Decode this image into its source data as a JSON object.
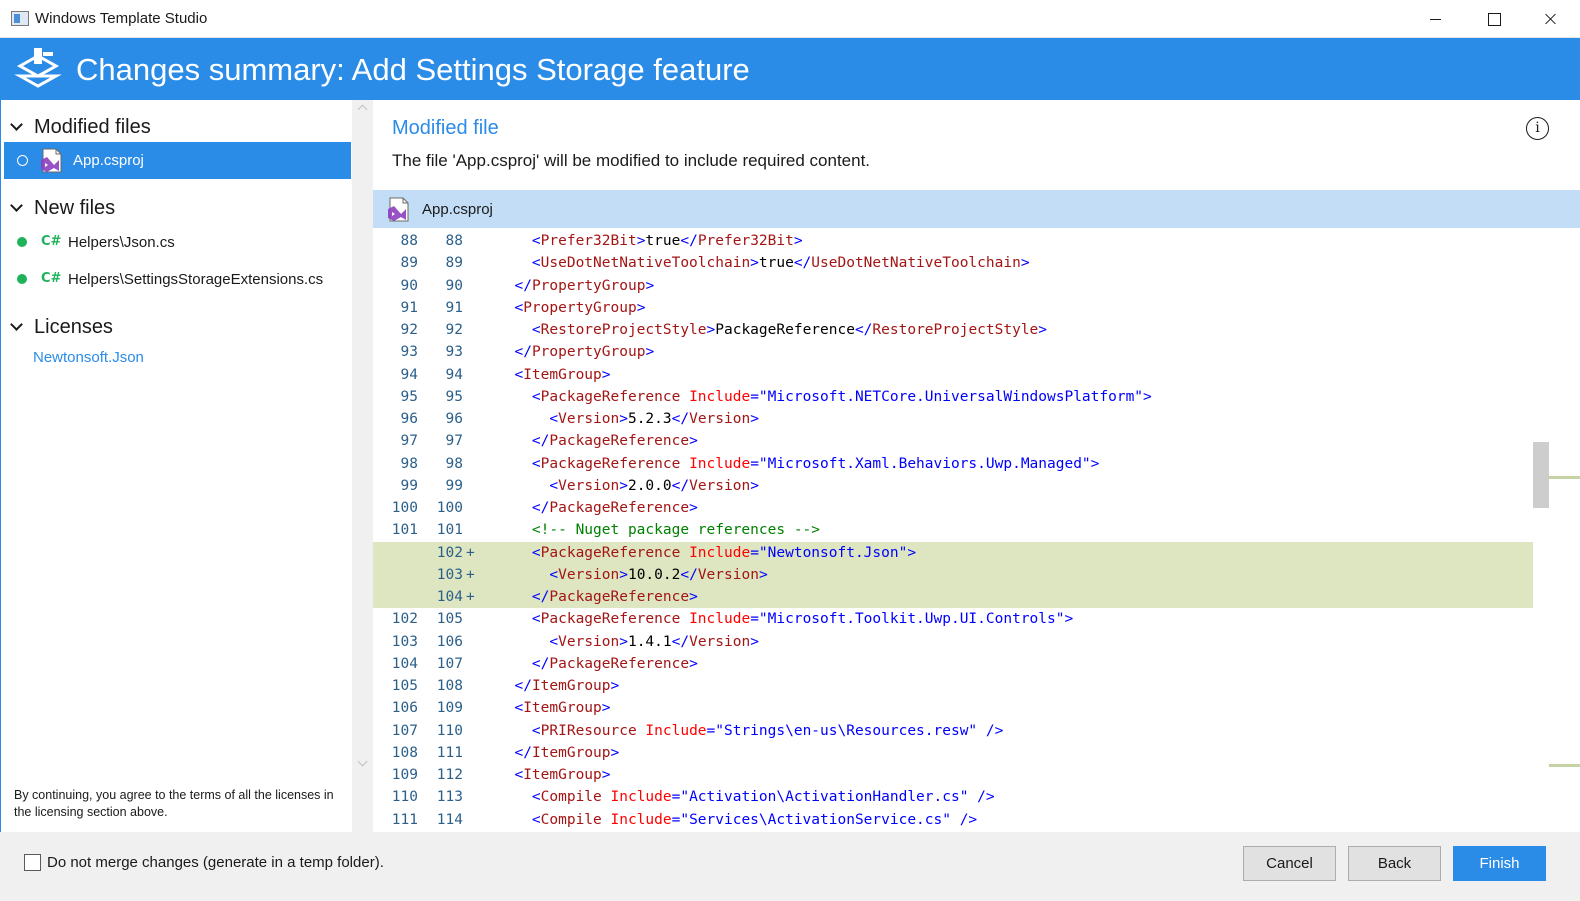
{
  "window": {
    "title": "Windows Template Studio"
  },
  "header": {
    "title": "Changes summary: Add Settings Storage feature"
  },
  "sidebar": {
    "groups": [
      {
        "label": "Modified files",
        "items": [
          {
            "label": "App.csproj",
            "selected": true
          }
        ]
      },
      {
        "label": "New files",
        "items": [
          {
            "label": "Helpers\\Json.cs",
            "icon": "csharp-icon"
          },
          {
            "label": "Helpers\\SettingsStorageExtensions.cs",
            "icon": "csharp-icon"
          }
        ]
      },
      {
        "label": "Licenses",
        "items": [
          {
            "label": "Newtonsoft.Json"
          }
        ]
      }
    ],
    "terms": "By continuing, you agree to the terms of all the licenses in the licensing section above."
  },
  "main": {
    "title": "Modified file",
    "description": "The file 'App.csproj' will be modified to include required content.",
    "file_name": "App.csproj"
  },
  "code_lines": [
    {
      "old": "88",
      "new": "88",
      "mark": "",
      "added": false,
      "segs": [
        [
          "",
          "    "
        ],
        [
          "br",
          "<"
        ],
        [
          "tag",
          "Prefer32Bit"
        ],
        [
          "br",
          ">"
        ],
        [
          "txt",
          "true"
        ],
        [
          "br",
          "</"
        ],
        [
          "tag",
          "Prefer32Bit"
        ],
        [
          "br",
          ">"
        ]
      ]
    },
    {
      "old": "89",
      "new": "89",
      "mark": "",
      "added": false,
      "segs": [
        [
          "",
          "    "
        ],
        [
          "br",
          "<"
        ],
        [
          "tag",
          "UseDotNetNativeToolchain"
        ],
        [
          "br",
          ">"
        ],
        [
          "txt",
          "true"
        ],
        [
          "br",
          "</"
        ],
        [
          "tag",
          "UseDotNetNativeToolchain"
        ],
        [
          "br",
          ">"
        ]
      ]
    },
    {
      "old": "90",
      "new": "90",
      "mark": "",
      "added": false,
      "segs": [
        [
          "",
          "  "
        ],
        [
          "br",
          "</"
        ],
        [
          "tag",
          "PropertyGroup"
        ],
        [
          "br",
          ">"
        ]
      ]
    },
    {
      "old": "91",
      "new": "91",
      "mark": "",
      "added": false,
      "segs": [
        [
          "",
          "  "
        ],
        [
          "br",
          "<"
        ],
        [
          "tag",
          "PropertyGroup"
        ],
        [
          "br",
          ">"
        ]
      ]
    },
    {
      "old": "92",
      "new": "92",
      "mark": "",
      "added": false,
      "segs": [
        [
          "",
          "    "
        ],
        [
          "br",
          "<"
        ],
        [
          "tag",
          "RestoreProjectStyle"
        ],
        [
          "br",
          ">"
        ],
        [
          "txt",
          "PackageReference"
        ],
        [
          "br",
          "</"
        ],
        [
          "tag",
          "RestoreProjectStyle"
        ],
        [
          "br",
          ">"
        ]
      ]
    },
    {
      "old": "93",
      "new": "93",
      "mark": "",
      "added": false,
      "segs": [
        [
          "",
          "  "
        ],
        [
          "br",
          "</"
        ],
        [
          "tag",
          "PropertyGroup"
        ],
        [
          "br",
          ">"
        ]
      ]
    },
    {
      "old": "94",
      "new": "94",
      "mark": "",
      "added": false,
      "segs": [
        [
          "",
          "  "
        ],
        [
          "br",
          "<"
        ],
        [
          "tag",
          "ItemGroup"
        ],
        [
          "br",
          ">"
        ]
      ]
    },
    {
      "old": "95",
      "new": "95",
      "mark": "",
      "added": false,
      "segs": [
        [
          "",
          "    "
        ],
        [
          "br",
          "<"
        ],
        [
          "tag",
          "PackageReference"
        ],
        [
          "",
          " "
        ],
        [
          "attr",
          "Include"
        ],
        [
          "br",
          "="
        ],
        [
          "val",
          "\"Microsoft.NETCore.UniversalWindowsPlatform\""
        ],
        [
          "br",
          ">"
        ]
      ]
    },
    {
      "old": "96",
      "new": "96",
      "mark": "",
      "added": false,
      "segs": [
        [
          "",
          "      "
        ],
        [
          "br",
          "<"
        ],
        [
          "tag",
          "Version"
        ],
        [
          "br",
          ">"
        ],
        [
          "txt",
          "5.2.3"
        ],
        [
          "br",
          "</"
        ],
        [
          "tag",
          "Version"
        ],
        [
          "br",
          ">"
        ]
      ]
    },
    {
      "old": "97",
      "new": "97",
      "mark": "",
      "added": false,
      "segs": [
        [
          "",
          "    "
        ],
        [
          "br",
          "</"
        ],
        [
          "tag",
          "PackageReference"
        ],
        [
          "br",
          ">"
        ]
      ]
    },
    {
      "old": "98",
      "new": "98",
      "mark": "",
      "added": false,
      "segs": [
        [
          "",
          "    "
        ],
        [
          "br",
          "<"
        ],
        [
          "tag",
          "PackageReference"
        ],
        [
          "",
          " "
        ],
        [
          "attr",
          "Include"
        ],
        [
          "br",
          "="
        ],
        [
          "val",
          "\"Microsoft.Xaml.Behaviors.Uwp.Managed\""
        ],
        [
          "br",
          ">"
        ]
      ]
    },
    {
      "old": "99",
      "new": "99",
      "mark": "",
      "added": false,
      "segs": [
        [
          "",
          "      "
        ],
        [
          "br",
          "<"
        ],
        [
          "tag",
          "Version"
        ],
        [
          "br",
          ">"
        ],
        [
          "txt",
          "2.0.0"
        ],
        [
          "br",
          "</"
        ],
        [
          "tag",
          "Version"
        ],
        [
          "br",
          ">"
        ]
      ]
    },
    {
      "old": "100",
      "new": "100",
      "mark": "",
      "added": false,
      "segs": [
        [
          "",
          "    "
        ],
        [
          "br",
          "</"
        ],
        [
          "tag",
          "PackageReference"
        ],
        [
          "br",
          ">"
        ]
      ]
    },
    {
      "old": "101",
      "new": "101",
      "mark": "",
      "added": false,
      "segs": [
        [
          "",
          "    "
        ],
        [
          "com",
          "<!-- Nuget package references -->"
        ]
      ]
    },
    {
      "old": "",
      "new": "102",
      "mark": "+",
      "added": true,
      "segs": [
        [
          "",
          "    "
        ],
        [
          "br",
          "<"
        ],
        [
          "tag",
          "PackageReference"
        ],
        [
          "",
          " "
        ],
        [
          "attr",
          "Include"
        ],
        [
          "br",
          "="
        ],
        [
          "val",
          "\"Newtonsoft.Json\""
        ],
        [
          "br",
          ">"
        ]
      ]
    },
    {
      "old": "",
      "new": "103",
      "mark": "+",
      "added": true,
      "segs": [
        [
          "",
          "      "
        ],
        [
          "br",
          "<"
        ],
        [
          "tag",
          "Version"
        ],
        [
          "br",
          ">"
        ],
        [
          "txt",
          "10.0.2"
        ],
        [
          "br",
          "</"
        ],
        [
          "tag",
          "Version"
        ],
        [
          "br",
          ">"
        ]
      ]
    },
    {
      "old": "",
      "new": "104",
      "mark": "+",
      "added": true,
      "segs": [
        [
          "",
          "    "
        ],
        [
          "br",
          "</"
        ],
        [
          "tag",
          "PackageReference"
        ],
        [
          "br",
          ">"
        ]
      ]
    },
    {
      "old": "102",
      "new": "105",
      "mark": "",
      "added": false,
      "segs": [
        [
          "",
          "    "
        ],
        [
          "br",
          "<"
        ],
        [
          "tag",
          "PackageReference"
        ],
        [
          "",
          " "
        ],
        [
          "attr",
          "Include"
        ],
        [
          "br",
          "="
        ],
        [
          "val",
          "\"Microsoft.Toolkit.Uwp.UI.Controls\""
        ],
        [
          "br",
          ">"
        ]
      ]
    },
    {
      "old": "103",
      "new": "106",
      "mark": "",
      "added": false,
      "segs": [
        [
          "",
          "      "
        ],
        [
          "br",
          "<"
        ],
        [
          "tag",
          "Version"
        ],
        [
          "br",
          ">"
        ],
        [
          "txt",
          "1.4.1"
        ],
        [
          "br",
          "</"
        ],
        [
          "tag",
          "Version"
        ],
        [
          "br",
          ">"
        ]
      ]
    },
    {
      "old": "104",
      "new": "107",
      "mark": "",
      "added": false,
      "segs": [
        [
          "",
          "    "
        ],
        [
          "br",
          "</"
        ],
        [
          "tag",
          "PackageReference"
        ],
        [
          "br",
          ">"
        ]
      ]
    },
    {
      "old": "105",
      "new": "108",
      "mark": "",
      "added": false,
      "segs": [
        [
          "",
          "  "
        ],
        [
          "br",
          "</"
        ],
        [
          "tag",
          "ItemGroup"
        ],
        [
          "br",
          ">"
        ]
      ]
    },
    {
      "old": "106",
      "new": "109",
      "mark": "",
      "added": false,
      "segs": [
        [
          "",
          "  "
        ],
        [
          "br",
          "<"
        ],
        [
          "tag",
          "ItemGroup"
        ],
        [
          "br",
          ">"
        ]
      ]
    },
    {
      "old": "107",
      "new": "110",
      "mark": "",
      "added": false,
      "segs": [
        [
          "",
          "    "
        ],
        [
          "br",
          "<"
        ],
        [
          "tag",
          "PRIResource"
        ],
        [
          "",
          " "
        ],
        [
          "attr",
          "Include"
        ],
        [
          "br",
          "="
        ],
        [
          "val",
          "\"Strings\\en-us\\Resources.resw\""
        ],
        [
          "",
          " "
        ],
        [
          "br",
          "/>"
        ]
      ]
    },
    {
      "old": "108",
      "new": "111",
      "mark": "",
      "added": false,
      "segs": [
        [
          "",
          "  "
        ],
        [
          "br",
          "</"
        ],
        [
          "tag",
          "ItemGroup"
        ],
        [
          "br",
          ">"
        ]
      ]
    },
    {
      "old": "109",
      "new": "112",
      "mark": "",
      "added": false,
      "segs": [
        [
          "",
          "  "
        ],
        [
          "br",
          "<"
        ],
        [
          "tag",
          "ItemGroup"
        ],
        [
          "br",
          ">"
        ]
      ]
    },
    {
      "old": "110",
      "new": "113",
      "mark": "",
      "added": false,
      "segs": [
        [
          "",
          "    "
        ],
        [
          "br",
          "<"
        ],
        [
          "tag",
          "Compile"
        ],
        [
          "",
          " "
        ],
        [
          "attr",
          "Include"
        ],
        [
          "br",
          "="
        ],
        [
          "val",
          "\"Activation\\ActivationHandler.cs\""
        ],
        [
          "",
          " "
        ],
        [
          "br",
          "/>"
        ]
      ]
    },
    {
      "old": "111",
      "new": "114",
      "mark": "",
      "added": false,
      "segs": [
        [
          "",
          "    "
        ],
        [
          "br",
          "<"
        ],
        [
          "tag",
          "Compile"
        ],
        [
          "",
          " "
        ],
        [
          "attr",
          "Include"
        ],
        [
          "br",
          "="
        ],
        [
          "val",
          "\"Services\\ActivationService.cs\""
        ],
        [
          "",
          " "
        ],
        [
          "br",
          "/>"
        ]
      ]
    }
  ],
  "footer": {
    "checkbox_label": "Do not merge changes (generate in a temp folder).",
    "checkbox_checked": false,
    "cancel_label": "Cancel",
    "back_label": "Back",
    "finish_label": "Finish"
  },
  "colors": {
    "accent": "#2b8ce8",
    "selected_bar": "#c3ddf7",
    "added_line": "#dde6c1",
    "new_file_dot": "#1fb25a",
    "xml_tag": "#a31515",
    "xml_bracket": "#0000ff",
    "xml_attribute": "#ff0000",
    "xml_comment": "#008000"
  }
}
